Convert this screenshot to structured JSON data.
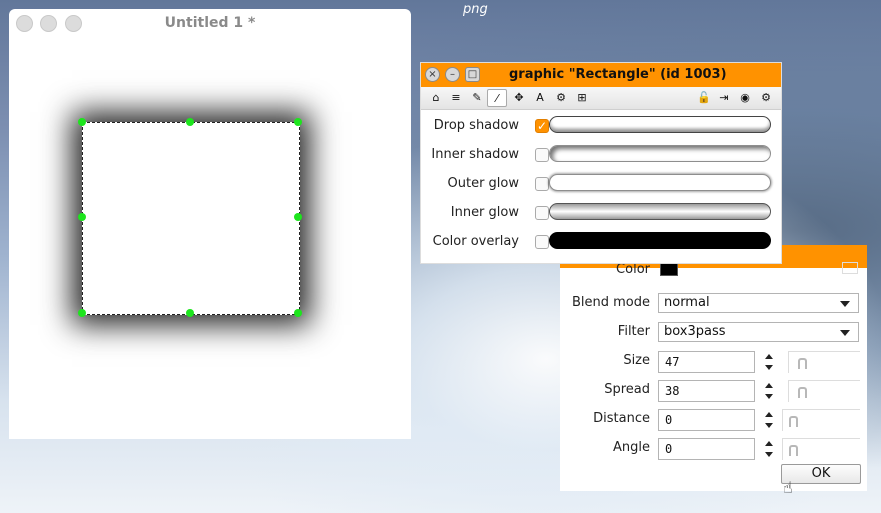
{
  "desktop": {
    "label": "png"
  },
  "doc": {
    "title": "Untitled 1 *"
  },
  "props": {
    "title": "graphic \"Rectangle\" (id 1003)",
    "effects": [
      {
        "label": "Drop shadow",
        "checked": true
      },
      {
        "label": "Inner shadow",
        "checked": false
      },
      {
        "label": "Outer glow",
        "checked": false
      },
      {
        "label": "Inner glow",
        "checked": false
      },
      {
        "label": "Color overlay",
        "checked": false
      }
    ],
    "toolbar": {
      "home": "⌂",
      "stack": "≡",
      "pencil": "✎",
      "wand": "⁄",
      "move": "✥",
      "text": "A",
      "gears": "⚙",
      "grid": "⊞",
      "lock": "🔓",
      "export": "⇥",
      "target": "◉",
      "settings": "⚙"
    },
    "check_mark": "✓",
    "buttons": {
      "close": "×",
      "minimize": "–",
      "maximize": "□"
    }
  },
  "editor": {
    "color_label": "Color",
    "color_value": "#000000",
    "blend_label": "Blend mode",
    "blend_value": "normal",
    "filter_label": "Filter",
    "filter_value": "box3pass",
    "size_label": "Size",
    "size_value": "47",
    "spread_label": "Spread",
    "spread_value": "38",
    "distance_label": "Distance",
    "distance_value": "0",
    "angle_label": "Angle",
    "angle_value": "0",
    "ok_label": "OK"
  },
  "colors": {
    "accent": "#ff9200",
    "handle": "#1de51d"
  }
}
